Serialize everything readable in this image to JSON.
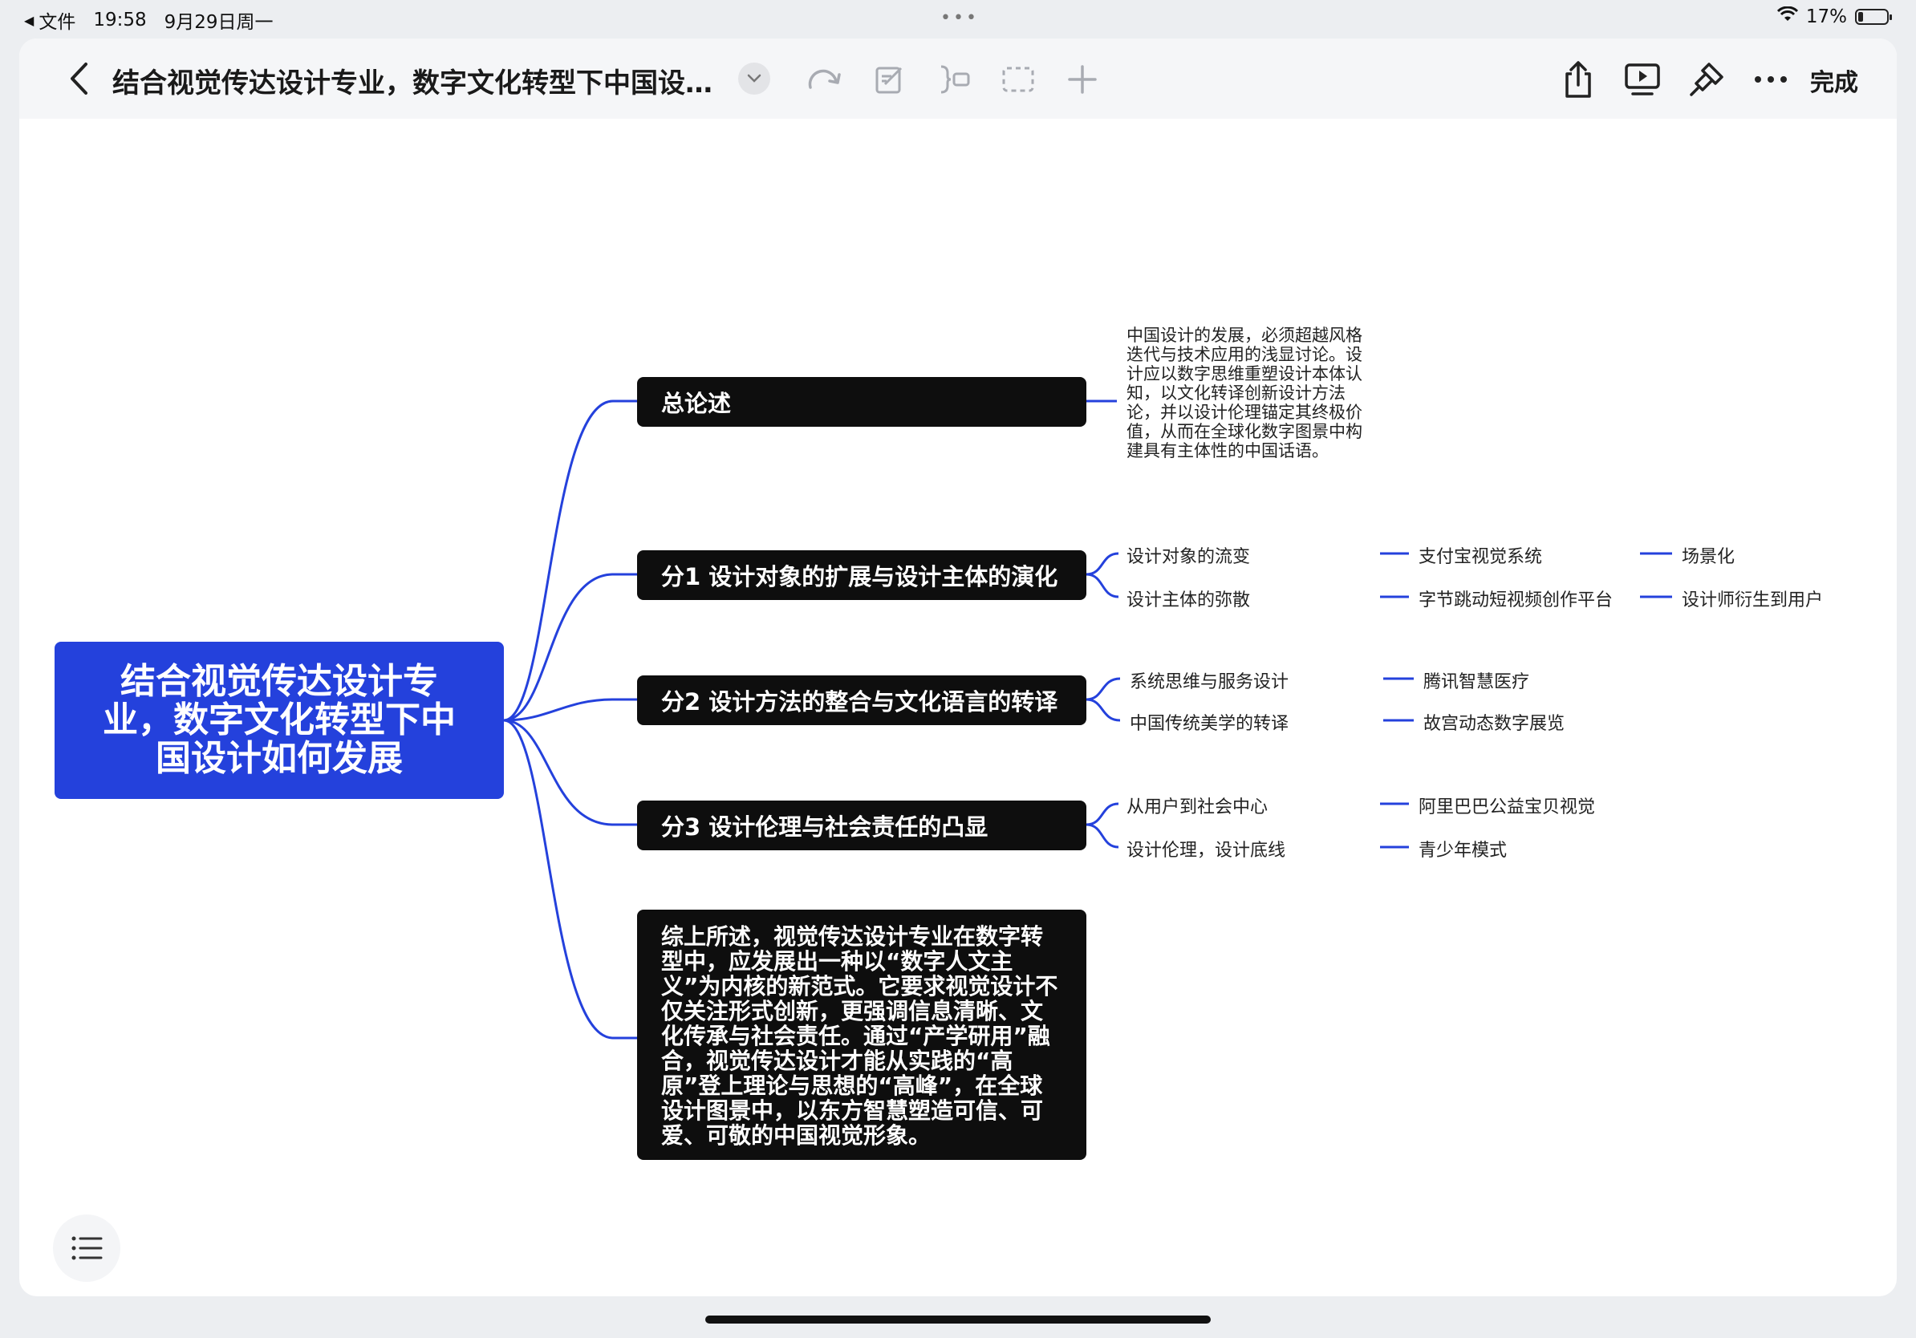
{
  "status_bar": {
    "back_app": "文件",
    "time": "19:58",
    "date": "9月29日周一",
    "battery": "17%"
  },
  "toolbar": {
    "title": "结合视觉传达设计专业，数字文化转型下中国设…",
    "done_label": "完成"
  },
  "mindmap": {
    "root": "结合视觉传达设计专业，数字文化转型下中国设计如何发展",
    "branches": [
      {
        "label": "总论述",
        "note": "中国设计的发展，必须超越风格迭代与技术应用的浅显讨论。设计应以数字思维重塑设计本体认知，以文化转译创新设计方法论，并以设计伦理锚定其终极价值，从而在全球化数字图景中构建具有主体性的中国话语。"
      },
      {
        "label": "分1 设计对象的扩展与设计主体的演化",
        "children": [
          {
            "label": "设计对象的流变",
            "example": "支付宝视觉系统",
            "detail": "场景化"
          },
          {
            "label": "设计主体的弥散",
            "example": "字节跳动短视频创作平台",
            "detail": "设计师衍生到用户"
          }
        ]
      },
      {
        "label": "分2 设计方法的整合与文化语言的转译",
        "children": [
          {
            "label": "系统思维与服务设计",
            "example": "腾讯智慧医疗"
          },
          {
            "label": "中国传统美学的转译",
            "example": "故宫动态数字展览"
          }
        ]
      },
      {
        "label": "分3 设计伦理与社会责任的凸显",
        "children": [
          {
            "label": "从用户到社会中心",
            "example": "阿里巴巴公益宝贝视觉"
          },
          {
            "label": "设计伦理，设计底线",
            "example": "青少年模式"
          }
        ]
      },
      {
        "label": "综上所述，视觉传达设计专业在数字转型中，应发展出一种以“数字人文主义”为内核的新范式。它要求视觉设计不仅关注形式创新，更强调信息清晰、文化传承与社会责任。通过“产学研用”融合，视觉传达设计才能从实践的“高原”登上理论与思想的“高峰”，在全球设计图景中，以东方智慧塑造可信、可爱、可敬的中国视觉形象。"
      }
    ]
  },
  "colors": {
    "root_bg": "#2441dc",
    "branch_bg": "#0e0e0e",
    "connector": "#2441dc"
  },
  "icons": [
    "back-arrow-icon",
    "chevron-down-icon",
    "redo-icon",
    "edit-icon",
    "insert-node-icon",
    "select-box-icon",
    "plus-icon",
    "share-icon",
    "present-icon",
    "format-brush-icon",
    "more-icon",
    "outline-list-icon",
    "wifi-icon",
    "battery-icon"
  ]
}
